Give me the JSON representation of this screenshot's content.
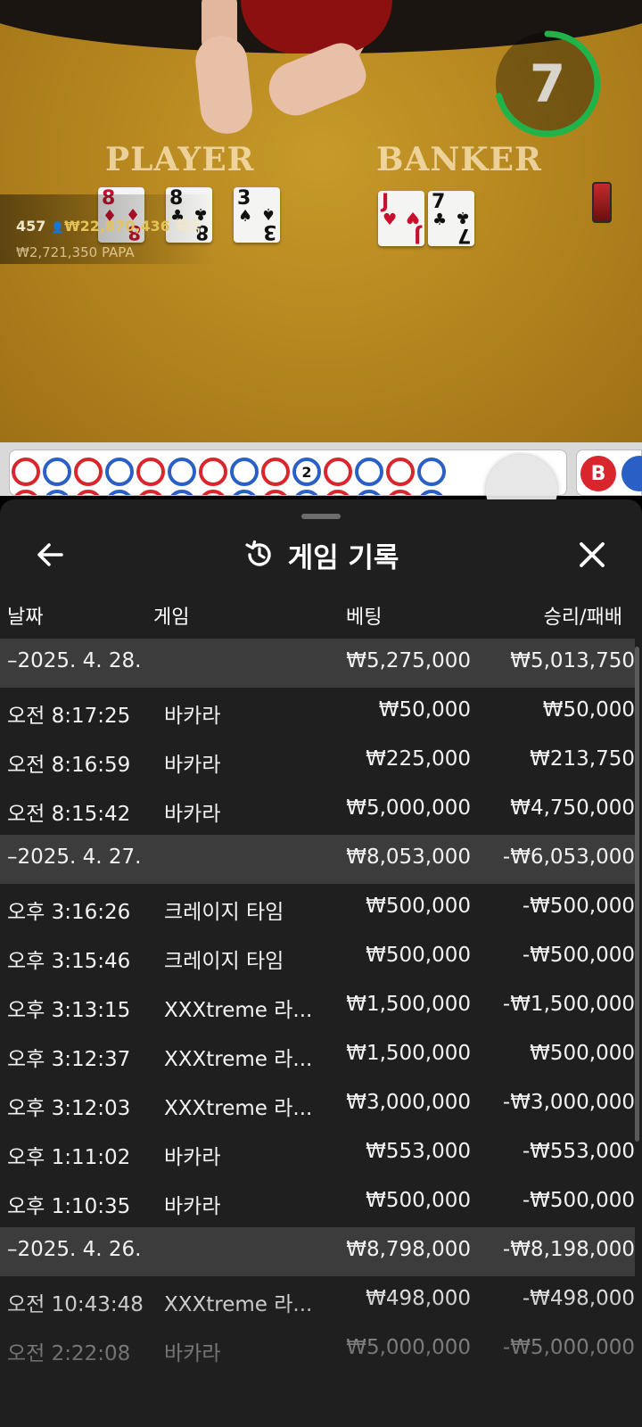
{
  "game_view": {
    "player_label": "PLAYER",
    "banker_label": "BANKER",
    "timer_value": "7",
    "player_cards": [
      {
        "rank": "8",
        "suit": "♦",
        "color": "red"
      },
      {
        "rank": "8",
        "suit": "♣",
        "color": "black"
      },
      {
        "rank": "3",
        "suit": "♠",
        "color": "black"
      }
    ],
    "banker_cards": [
      {
        "rank": "J",
        "suit": "♥",
        "color": "red"
      },
      {
        "rank": "7",
        "suit": "♣",
        "color": "black"
      }
    ],
    "player_count": "457",
    "total_bet": "₩22,870,436",
    "total_bet_suffix": "획득",
    "user_bet": "₩2,721,350",
    "user_name": "PAPA"
  },
  "roadmap": {
    "top_row": [
      "r",
      "b",
      "r",
      "b",
      "r",
      "b",
      "r",
      "b",
      "r",
      "b",
      "r",
      "b",
      "r",
      "b"
    ],
    "tie_number": "2",
    "b_badge": "B",
    "colors": {
      "banker": "#d8262c",
      "player": "#2a5fc5"
    }
  },
  "history": {
    "title": "게임 기록",
    "icons": {
      "back": "arrow-left-icon",
      "history": "history-icon",
      "close": "close-icon"
    },
    "columns": {
      "date": "날짜",
      "game": "게임",
      "bet": "베팅",
      "result": "승리/패배"
    },
    "rows": [
      {
        "type": "date",
        "time": "–2025. 4. 28.",
        "game": "",
        "bet": "₩5,275,000",
        "result": "₩5,013,750"
      },
      {
        "type": "entry",
        "time": "오전 8:17:25",
        "game": "바카라",
        "bet": "₩50,000",
        "result": "₩50,000"
      },
      {
        "type": "entry",
        "time": "오전 8:16:59",
        "game": "바카라",
        "bet": "₩225,000",
        "result": "₩213,750"
      },
      {
        "type": "entry",
        "time": "오전 8:15:42",
        "game": "바카라",
        "bet": "₩5,000,000",
        "result": "₩4,750,000"
      },
      {
        "type": "date",
        "time": "–2025. 4. 27.",
        "game": "",
        "bet": "₩8,053,000",
        "result": "-₩6,053,000"
      },
      {
        "type": "entry",
        "time": "오후 3:16:26",
        "game": "크레이지 타임",
        "bet": "₩500,000",
        "result": "-₩500,000"
      },
      {
        "type": "entry",
        "time": "오후 3:15:46",
        "game": "크레이지 타임",
        "bet": "₩500,000",
        "result": "-₩500,000"
      },
      {
        "type": "entry",
        "time": "오후 3:13:15",
        "game": "XXXtreme 라...",
        "bet": "₩1,500,000",
        "result": "-₩1,500,000"
      },
      {
        "type": "entry",
        "time": "오후 3:12:37",
        "game": "XXXtreme 라...",
        "bet": "₩1,500,000",
        "result": "₩500,000"
      },
      {
        "type": "entry",
        "time": "오후 3:12:03",
        "game": "XXXtreme 라...",
        "bet": "₩3,000,000",
        "result": "-₩3,000,000"
      },
      {
        "type": "entry",
        "time": "오후 1:11:02",
        "game": "바카라",
        "bet": "₩553,000",
        "result": "-₩553,000"
      },
      {
        "type": "entry",
        "time": "오후 1:10:35",
        "game": "바카라",
        "bet": "₩500,000",
        "result": "-₩500,000"
      },
      {
        "type": "date",
        "time": "–2025. 4. 26.",
        "game": "",
        "bet": "₩8,798,000",
        "result": "-₩8,198,000"
      },
      {
        "type": "entry",
        "time": "오전 10:43:48",
        "game": "XXXtreme 라...",
        "bet": "₩498,000",
        "result": "-₩498,000"
      },
      {
        "type": "entry",
        "time": "오전 2:22:08",
        "game": "바카라",
        "bet": "₩5,000,000",
        "result": "-₩5,000,000"
      }
    ]
  }
}
